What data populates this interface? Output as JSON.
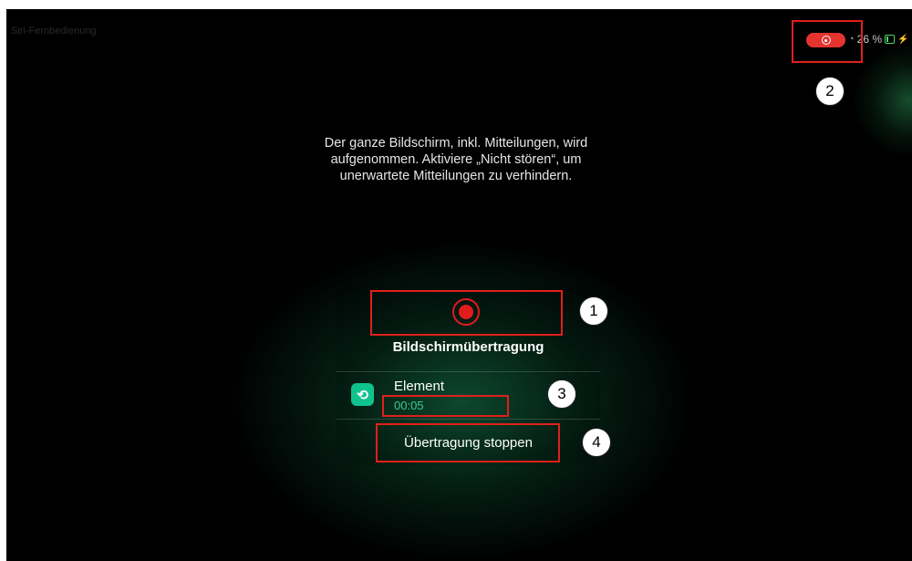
{
  "status_bar": {
    "left_text": "Siri-Fernbedienung",
    "battery_text": "26 %",
    "record_indicator_icon": "record-icon",
    "wifi_icon": "wifi-icon",
    "battery_icon": "battery-icon",
    "charging_icon": "lightning-icon"
  },
  "message": {
    "text": "Der ganze Bildschirm, inkl. Mitteilungen, wird aufgenommen. Aktiviere „Nicht stören“, um unerwartete Mitteilungen zu verhindern."
  },
  "panel": {
    "record_icon": "record-icon",
    "title": "Bildschirmübertragung",
    "app": {
      "icon": "element-app-icon",
      "name": "Element",
      "elapsed": "00:05"
    },
    "stop_label": "Übertragung stoppen"
  },
  "callouts": [
    "1",
    "2",
    "3",
    "4"
  ],
  "colors": {
    "record_red": "#e21c1c",
    "highlight_red": "#e0201b",
    "app_green": "#10c28e",
    "timer_green": "#3ec98f"
  }
}
